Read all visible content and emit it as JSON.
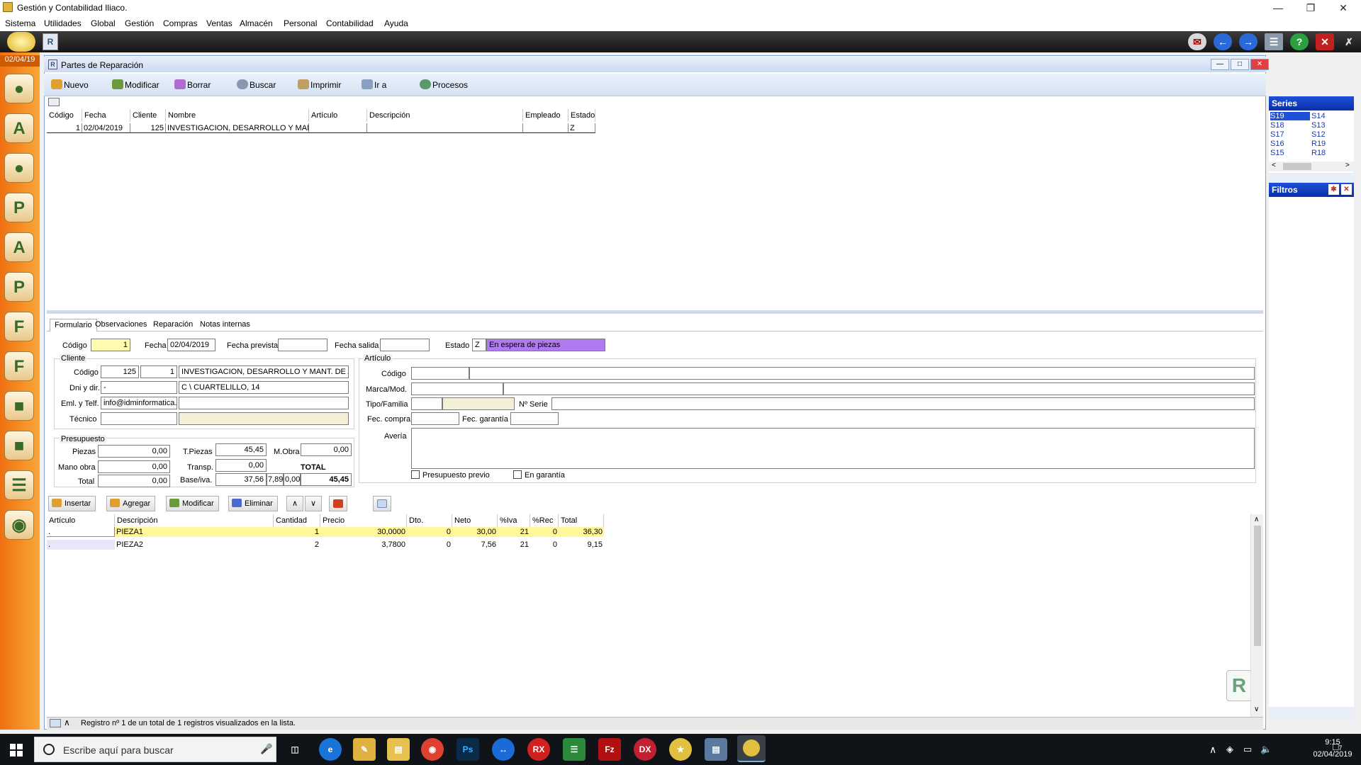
{
  "window": {
    "title": "Gestión y Contabilidad Iliaco."
  },
  "menu": [
    "Sistema",
    "Utilidades",
    "Global",
    "Gestión",
    "Compras",
    "Ventas",
    "Almacén",
    "Personal",
    "Contabilidad",
    "Ayuda"
  ],
  "sidebar": {
    "date": "02/04/19"
  },
  "child": {
    "title": "Partes de Reparación"
  },
  "actions": [
    "Nuevo",
    "Modificar",
    "Borrar",
    "Buscar",
    "Imprimir",
    "Ir a",
    "Procesos"
  ],
  "list": {
    "headers": [
      "Código",
      "Fecha",
      "Cliente",
      "Nombre",
      "Artículo",
      "Descripción",
      "Empleado",
      "Estado"
    ],
    "rows": [
      {
        "codigo": "1",
        "fecha": "02/04/2019",
        "cliente": "125",
        "nombre": "INVESTIGACION, DESARROLLO Y MAN",
        "articulo": "",
        "descripcion": "",
        "empleado": "",
        "estado": "Z"
      }
    ]
  },
  "series": {
    "title": "Series",
    "items": [
      "S19",
      "S14",
      "S18",
      "S13",
      "S17",
      "S12",
      "S16",
      "R19",
      "S15",
      "R18"
    ]
  },
  "filtros": {
    "title": "Filtros"
  },
  "tabs": [
    "Formulario",
    "Observaciones",
    "Reparación",
    "Notas internas"
  ],
  "form": {
    "codigo_label": "Código",
    "codigo": "1",
    "fecha_label": "Fecha",
    "fecha": "02/04/2019",
    "fecha_prevista_label": "Fecha prevista",
    "fecha_prevista": "",
    "fecha_salida_label": "Fecha salida",
    "fecha_salida": "",
    "estado_label": "Estado",
    "estado_code": "Z",
    "estado_text": "En espera de piezas",
    "cliente_group": "Cliente",
    "cli_codigo_label": "Código",
    "cli_codigo": "125",
    "cli_sub": "1",
    "cli_nombre": "INVESTIGACION, DESARROLLO Y MANT. DE A",
    "dni_label": "Dni y dir.",
    "dni": "-",
    "direccion": "C \\ CUARTELILLO, 14",
    "eml_label": "Eml. y Telf.",
    "email": "info@idminformatica.c",
    "telefono": "",
    "tecnico_label": "Técnico",
    "tecnico": "",
    "tecnico_name": "",
    "articulo_group": "Artículo",
    "art_codigo_label": "Código",
    "art_codigo": "",
    "art_desc": "",
    "marca_label": "Marca/Mod.",
    "marca": "",
    "modelo": "",
    "tipo_label": "Tipo/Familia",
    "tipo": "",
    "familia": "",
    "serie_label": "Nº Serie",
    "serie": "",
    "fec_compra_label": "Fec. compra",
    "fec_compra": "",
    "fec_garantia_label": "Fec. garantía",
    "fec_garantia": "",
    "averia_label": "Avería",
    "averia": "",
    "presupuesto_previo": "Presupuesto previo",
    "en_garantia": "En garantía",
    "presupuesto_group": "Presupuesto",
    "piezas_label": "Piezas",
    "piezas": "0,00",
    "mano_obra_label": "Mano obra",
    "mano_obra": "0,00",
    "total_label": "Total",
    "total": "0,00",
    "tpiezas_label": "T.Piezas",
    "tpiezas": "45,45",
    "mobra_label": "M.Obra",
    "mobra": "0,00",
    "transp_label": "Transp.",
    "transp": "0,00",
    "total_caption": "TOTAL",
    "base_label": "Base/iva.",
    "base": "37,56",
    "iva": "7,89",
    "rec": "0,00",
    "grand_total": "45,45"
  },
  "itembar": [
    "Insertar",
    "Agregar",
    "Modificar",
    "Eliminar"
  ],
  "lines": {
    "headers": [
      "Artículo",
      "Descripción",
      "Cantidad",
      "Precio",
      "Dto.",
      "Neto",
      "%Iva",
      "%Rec",
      "Total"
    ],
    "rows": [
      {
        "articulo": ".",
        "descripcion": "PIEZA1",
        "cantidad": "1",
        "precio": "30,0000",
        "dto": "0",
        "neto": "30,00",
        "iva": "21",
        "rec": "0",
        "total": "36,30"
      },
      {
        "articulo": ".",
        "descripcion": "PIEZA2",
        "cantidad": "2",
        "precio": "3,7800",
        "dto": "0",
        "neto": "7,56",
        "iva": "21",
        "rec": "0",
        "total": "9,15"
      }
    ]
  },
  "status": "Registro nº 1 de un total de 1 registros visualizados en la lista.",
  "taskbar": {
    "search_placeholder": "Escribe aquí para buscar",
    "time": "9:15",
    "date": "02/04/2019",
    "notif": "7"
  }
}
